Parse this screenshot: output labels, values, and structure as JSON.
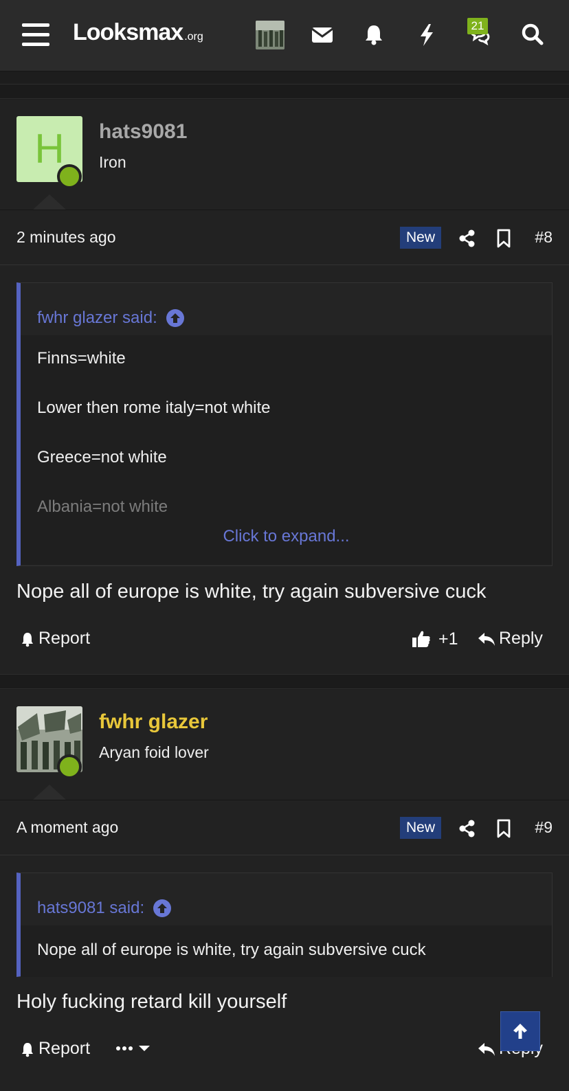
{
  "header": {
    "logo_main": "Looksmax",
    "logo_tld": ".org",
    "alerts_badge": "21"
  },
  "posts": [
    {
      "username": "hats9081",
      "user_title": "Iron",
      "avatar_letter": "H",
      "time": "2 minutes ago",
      "new_label": "New",
      "post_number": "#8",
      "quote": {
        "author_label": "fwhr glazer said:",
        "lines": [
          "Finns=white",
          "Lower then rome italy=not white",
          "Greece=not white",
          "Albania=not white"
        ],
        "expand_label": "Click to expand..."
      },
      "message": "Nope all of europe is white, try again subversive cuck",
      "report_label": "Report",
      "reaction_count": "+1",
      "reply_label": "Reply"
    },
    {
      "username": "fwhr glazer",
      "user_title": "Aryan foid lover",
      "time": "A moment ago",
      "new_label": "New",
      "post_number": "#9",
      "quote": {
        "author_label": "hats9081 said:",
        "lines": [
          "Nope all of europe is white, try again subversive cuck"
        ]
      },
      "message": "Holy fucking retard kill yourself",
      "report_label": "Report",
      "reply_label": "Reply"
    }
  ],
  "colors": {
    "background": "#1d1d1d",
    "header": "#2b2b2b",
    "accent_link": "#6877d6",
    "quote_border": "#5563c1",
    "new_tag": "#233e7a",
    "online": "#7fb21c",
    "username_highlight": "#e8c73a",
    "username_plain": "#a8a8a8"
  },
  "icons": [
    "menu-icon",
    "envelope-icon",
    "bell-icon",
    "bolt-icon",
    "chat-icon",
    "search-icon",
    "share-icon",
    "bookmark-icon",
    "arrow-up-circle-icon",
    "thumbs-up-icon",
    "reply-icon",
    "more-icon",
    "chevron-down-icon",
    "arrow-up-icon"
  ]
}
